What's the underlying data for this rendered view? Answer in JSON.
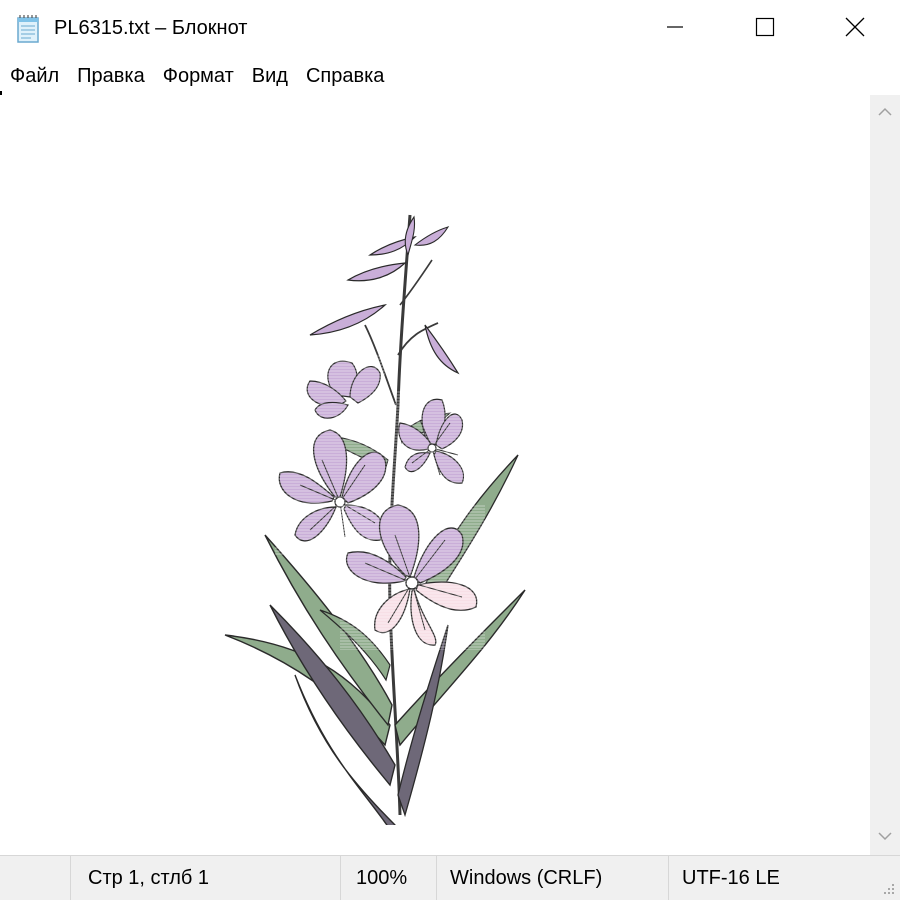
{
  "window": {
    "title": "PL6315.txt – Блокнот"
  },
  "menu": {
    "items": [
      "Файл",
      "Правка",
      "Формат",
      "Вид",
      "Справка"
    ]
  },
  "icons": {
    "app": "notepad-icon",
    "minimize": "minimize-icon",
    "maximize": "maximize-icon",
    "close": "close-icon",
    "scroll_up": "chevron-up-icon",
    "scroll_down": "chevron-down-icon",
    "grip": "resize-grip-icon"
  },
  "editor": {
    "content_description_visible": "line-art flower drawing"
  },
  "status": {
    "position": "Стр 1, стлб 1",
    "zoom": "100%",
    "line_ending": "Windows (CRLF)",
    "encoding": "UTF-16 LE"
  },
  "colors": {
    "petal_purple": "#c9aed8",
    "petal_pink": "#f7dfe6",
    "leaf_green": "#8fac8c",
    "leaf_dark": "#6e6878",
    "stem": "#3a3a3a"
  }
}
